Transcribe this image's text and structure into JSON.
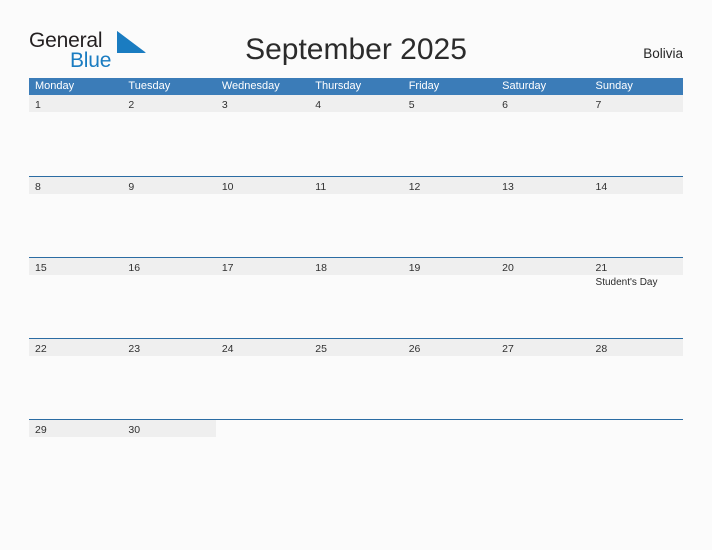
{
  "brand": {
    "name_part1": "General",
    "name_part2": "Blue",
    "flag_icon": "triangle-flag-icon",
    "accent_color": "#1a7cc1"
  },
  "header": {
    "title": "September 2025",
    "country": "Bolivia"
  },
  "calendar": {
    "month": "September",
    "year": "2025",
    "header_bg_color": "#3b7cb8",
    "row_divider_color": "#2b6ca3",
    "day_band_color": "#efefef",
    "weekdays": [
      "Monday",
      "Tuesday",
      "Wednesday",
      "Thursday",
      "Friday",
      "Saturday",
      "Sunday"
    ],
    "weeks": [
      [
        {
          "day": "1",
          "events": []
        },
        {
          "day": "2",
          "events": []
        },
        {
          "day": "3",
          "events": []
        },
        {
          "day": "4",
          "events": []
        },
        {
          "day": "5",
          "events": []
        },
        {
          "day": "6",
          "events": []
        },
        {
          "day": "7",
          "events": []
        }
      ],
      [
        {
          "day": "8",
          "events": []
        },
        {
          "day": "9",
          "events": []
        },
        {
          "day": "10",
          "events": []
        },
        {
          "day": "11",
          "events": []
        },
        {
          "day": "12",
          "events": []
        },
        {
          "day": "13",
          "events": []
        },
        {
          "day": "14",
          "events": []
        }
      ],
      [
        {
          "day": "15",
          "events": []
        },
        {
          "day": "16",
          "events": []
        },
        {
          "day": "17",
          "events": []
        },
        {
          "day": "18",
          "events": []
        },
        {
          "day": "19",
          "events": []
        },
        {
          "day": "20",
          "events": []
        },
        {
          "day": "21",
          "events": [
            "Student's Day"
          ]
        }
      ],
      [
        {
          "day": "22",
          "events": []
        },
        {
          "day": "23",
          "events": []
        },
        {
          "day": "24",
          "events": []
        },
        {
          "day": "25",
          "events": []
        },
        {
          "day": "26",
          "events": []
        },
        {
          "day": "27",
          "events": []
        },
        {
          "day": "28",
          "events": []
        }
      ],
      [
        {
          "day": "29",
          "events": []
        },
        {
          "day": "30",
          "events": []
        },
        {
          "day": "",
          "events": []
        },
        {
          "day": "",
          "events": []
        },
        {
          "day": "",
          "events": []
        },
        {
          "day": "",
          "events": []
        },
        {
          "day": "",
          "events": []
        }
      ]
    ]
  }
}
